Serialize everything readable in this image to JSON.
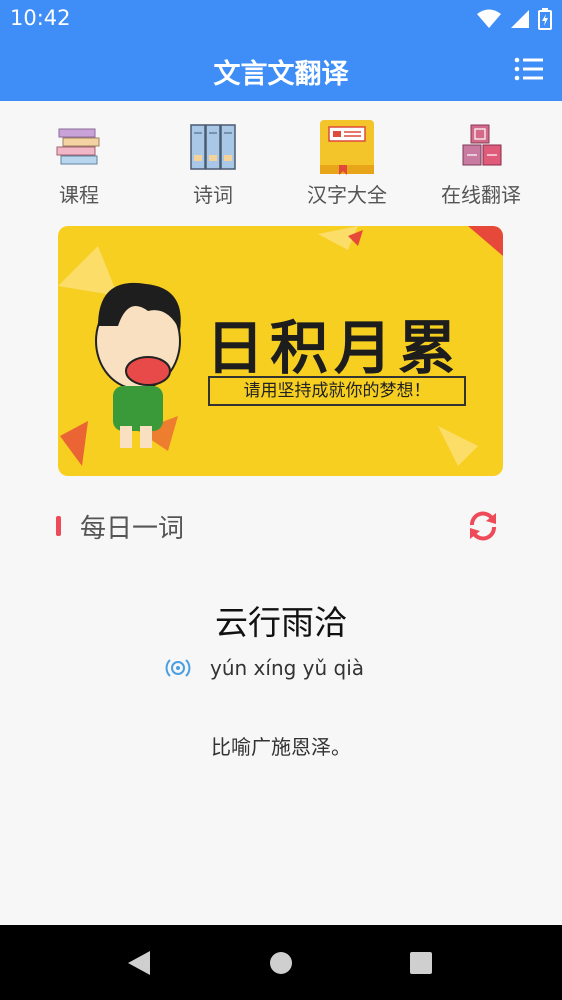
{
  "status_bar": {
    "time": "10:42"
  },
  "app_bar": {
    "title": "文言文翻译"
  },
  "nav": {
    "items": [
      {
        "label": "课程"
      },
      {
        "label": "诗词"
      },
      {
        "label": "汉字大全"
      },
      {
        "label": "在线翻译"
      }
    ]
  },
  "banner": {
    "title": "日积月累",
    "subtitle": "请用坚持成就你的梦想！"
  },
  "daily": {
    "section_title": "每日一词",
    "word": "云行雨洽",
    "pinyin": "yún xíng yǔ qià",
    "meaning": "比喻广施恩泽。"
  },
  "colors": {
    "primary": "#3f8ef7",
    "accent": "#ee4a5a",
    "banner_bg": "#f7cf20"
  }
}
